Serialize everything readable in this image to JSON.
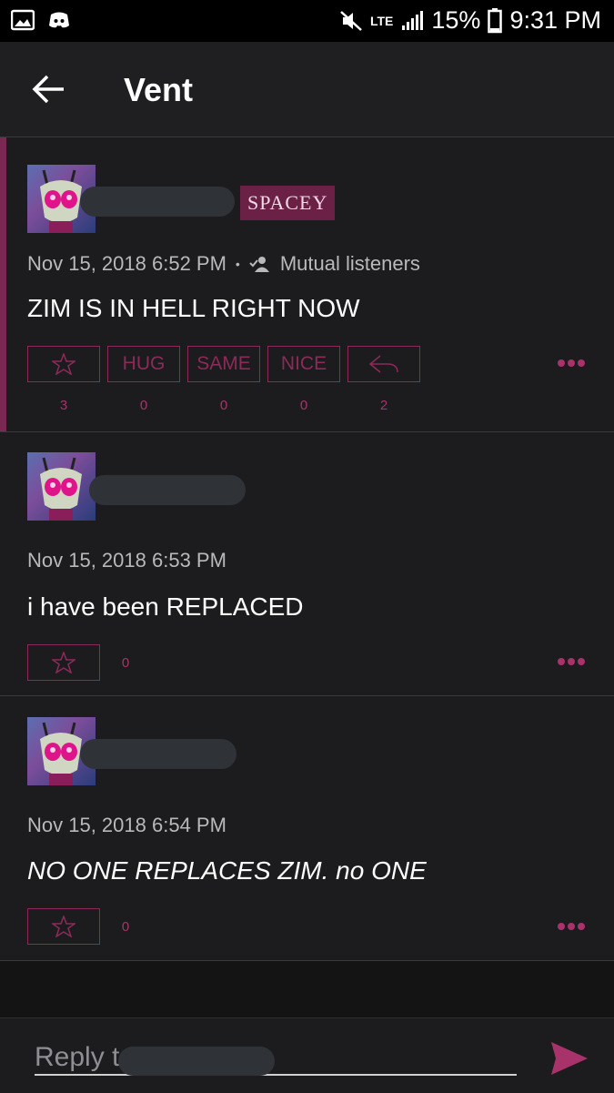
{
  "status_bar": {
    "network": "LTE",
    "battery": "15%",
    "time": "9:31 PM"
  },
  "header": {
    "title": "Vent"
  },
  "posts": [
    {
      "badge": "SPACEY",
      "timestamp": "Nov 15, 2018 6:52 PM",
      "separator": "•",
      "audience": "Mutual listeners",
      "text": "ZIM IS IN HELL RIGHT NOW",
      "reactions": [
        {
          "label": "",
          "icon": "star-icon",
          "count": "3"
        },
        {
          "label": "HUG",
          "count": "0"
        },
        {
          "label": "SAME",
          "count": "0"
        },
        {
          "label": "NICE",
          "count": "0"
        },
        {
          "label": "",
          "icon": "reply-icon",
          "count": "2"
        }
      ]
    },
    {
      "timestamp": "Nov 15, 2018 6:53 PM",
      "text": "i have been REPLACED",
      "star_count": "0"
    },
    {
      "timestamp": "Nov 15, 2018 6:54 PM",
      "text": "NO ONE REPLACES ZIM. no ONE",
      "star_count": "0"
    }
  ],
  "reply": {
    "placeholder": "Reply t"
  },
  "colors": {
    "accent": "#8c2a5a",
    "badge_bg": "#6b2146",
    "background": "#1c1c1e"
  }
}
